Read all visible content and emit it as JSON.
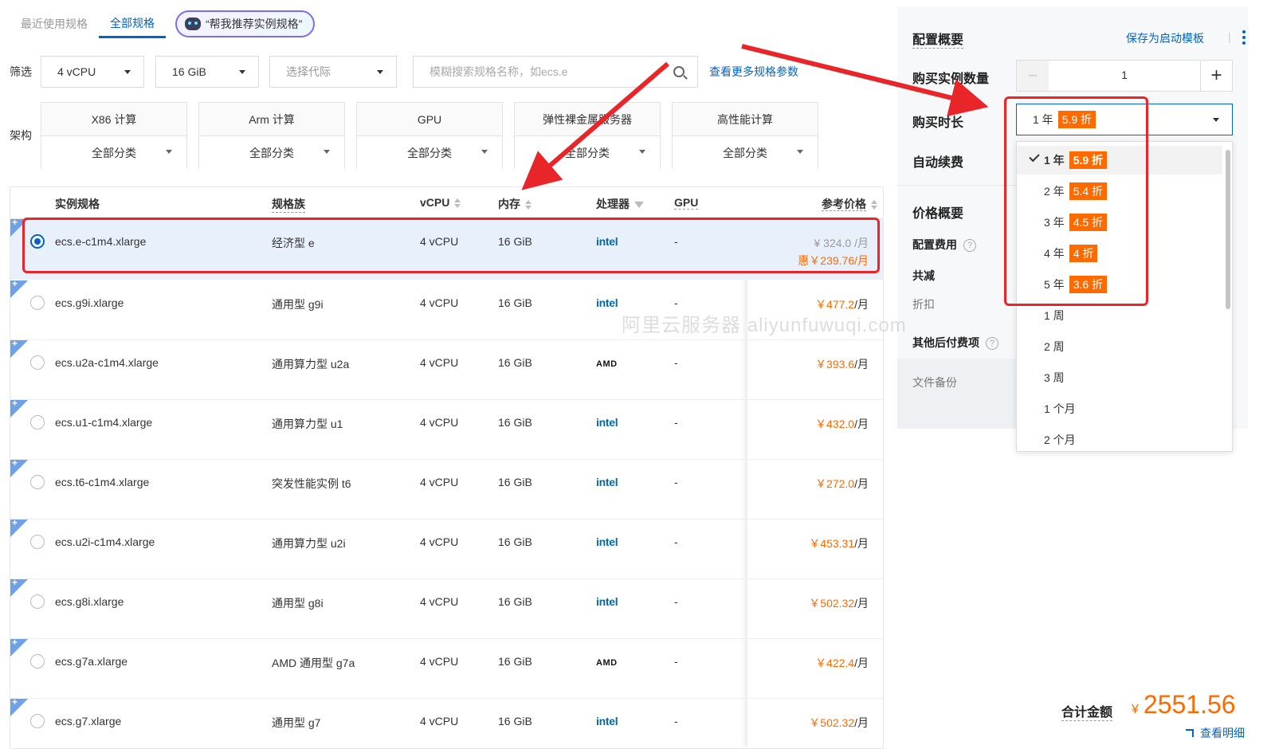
{
  "tabs": [
    "最近使用规格",
    "全部规格"
  ],
  "recommend_button": "“帮我推荐实例规格”",
  "filter": {
    "label": "筛选",
    "vcpu": "4 vCPU",
    "memory": "16 GiB",
    "generation_placeholder": "选择代际",
    "search_placeholder": "模糊搜索规格名称，如ecs.e",
    "more_params_link": "查看更多规格参数"
  },
  "arch": {
    "label": "架构",
    "items": [
      {
        "name": "X86 计算",
        "sub": "全部分类"
      },
      {
        "name": "Arm 计算",
        "sub": "全部分类"
      },
      {
        "name": "GPU",
        "sub": "全部分类"
      },
      {
        "name": "弹性裸金属服务器",
        "sub": "全部分类"
      },
      {
        "name": "高性能计算",
        "sub": "全部分类"
      }
    ]
  },
  "table": {
    "headers": {
      "spec": "实例规格",
      "family": "规格族",
      "vcpu": "vCPU",
      "memory": "内存",
      "cpu": "处理器",
      "gpu": "GPU",
      "price": "参考价格"
    },
    "rows": [
      {
        "spec": "ecs.e-c1m4.xlarge",
        "family": "经济型 e",
        "vcpu": "4 vCPU",
        "mem": "16 GiB",
        "cpu": "intel",
        "gpu": "-",
        "orig_price": "¥ 324.0 /月",
        "disc_price": "惠￥239.76/月",
        "selected": true
      },
      {
        "spec": "ecs.g9i.xlarge",
        "family": "通用型 g9i",
        "vcpu": "4 vCPU",
        "mem": "16 GiB",
        "cpu": "intel",
        "gpu": "-",
        "price": "￥477.2",
        "unit": "/月"
      },
      {
        "spec": "ecs.u2a-c1m4.xlarge",
        "family": "通用算力型 u2a",
        "vcpu": "4 vCPU",
        "mem": "16 GiB",
        "cpu": "AMD",
        "gpu": "-",
        "price": "￥393.6",
        "unit": "/月"
      },
      {
        "spec": "ecs.u1-c1m4.xlarge",
        "family": "通用算力型 u1",
        "vcpu": "4 vCPU",
        "mem": "16 GiB",
        "cpu": "intel",
        "gpu": "-",
        "price": "￥432.0",
        "unit": "/月"
      },
      {
        "spec": "ecs.t6-c1m4.xlarge",
        "family": "突发性能实例 t6",
        "vcpu": "4 vCPU",
        "mem": "16 GiB",
        "cpu": "intel",
        "gpu": "-",
        "price": "￥272.0",
        "unit": "/月"
      },
      {
        "spec": "ecs.u2i-c1m4.xlarge",
        "family": "通用算力型 u2i",
        "vcpu": "4 vCPU",
        "mem": "16 GiB",
        "cpu": "intel",
        "gpu": "-",
        "price": "￥453.31",
        "unit": "/月"
      },
      {
        "spec": "ecs.g8i.xlarge",
        "family": "通用型 g8i",
        "vcpu": "4 vCPU",
        "mem": "16 GiB",
        "cpu": "intel",
        "gpu": "-",
        "price": "￥502.32",
        "unit": "/月"
      },
      {
        "spec": "ecs.g7a.xlarge",
        "family": "AMD 通用型 g7a",
        "vcpu": "4 vCPU",
        "mem": "16 GiB",
        "cpu": "AMD",
        "gpu": "-",
        "price": "￥422.4",
        "unit": "/月"
      },
      {
        "spec": "ecs.g7.xlarge",
        "family": "通用型 g7",
        "vcpu": "4 vCPU",
        "mem": "16 GiB",
        "cpu": "intel",
        "gpu": "-",
        "price": "￥502.32",
        "unit": "/月"
      }
    ]
  },
  "right": {
    "config_summary": "配置概要",
    "save_template": "保存为启动模板",
    "separator": "|",
    "qty_label": "购买实例数量",
    "qty_value": "1",
    "duration_label": "购买时长",
    "duration_value": "1 年",
    "duration_discount": "5.9 折",
    "auto_renew": "自动续费",
    "price_summary": "价格概要",
    "config_fee": "配置费用",
    "total_reduce": "共减",
    "discount": "折扣",
    "other_fees": "其他后付费项",
    "file_backup": "文件备份",
    "total_label": "合计金额",
    "total_yen": "¥",
    "total_value": "2551.56",
    "detail_link": "查看明细",
    "help_mark": "?"
  },
  "dropdown": [
    {
      "label": "1 年",
      "tag": "5.9 折",
      "active": true
    },
    {
      "label": "2 年",
      "tag": "5.4 折"
    },
    {
      "label": "3 年",
      "tag": "4.5 折"
    },
    {
      "label": "4 年",
      "tag": "4 折"
    },
    {
      "label": "5 年",
      "tag": "3.6 折"
    },
    {
      "label": "1 周"
    },
    {
      "label": "2 周"
    },
    {
      "label": "3 周"
    },
    {
      "label": "1 个月"
    },
    {
      "label": "2 个月"
    }
  ],
  "watermark": "阿里云服务器 aliyunfuwuqi.com",
  "colors": {
    "accent": "#0064c8",
    "price": "#ff6a00",
    "annotation": "#e8262a"
  }
}
